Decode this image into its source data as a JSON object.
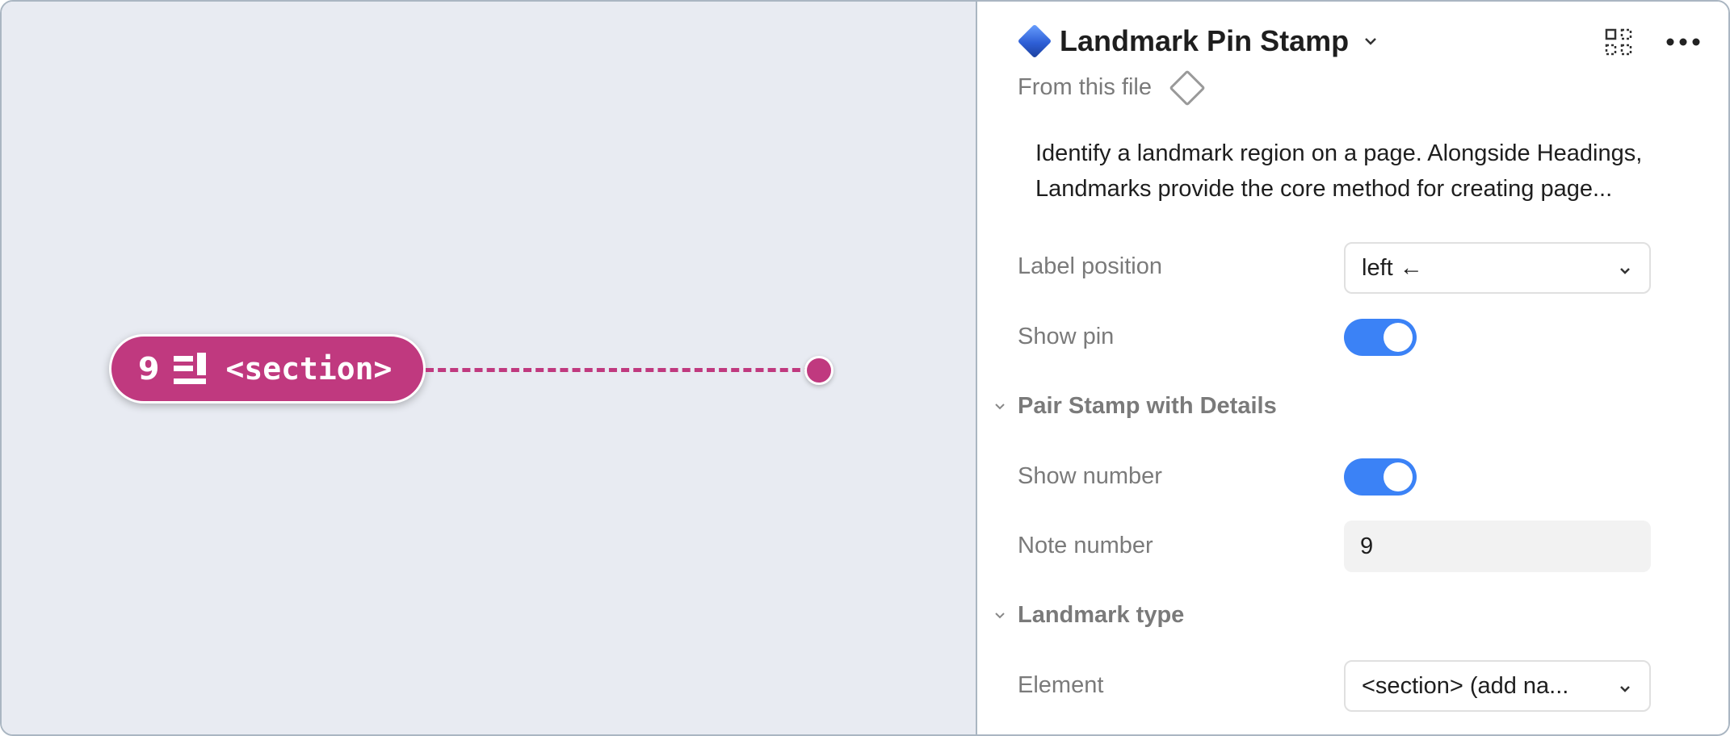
{
  "canvas": {
    "stamp": {
      "number": "9",
      "tag": "<section>"
    },
    "colors": {
      "stamp": "#c0397f",
      "canvas_bg": "#e8ebf2"
    }
  },
  "panel": {
    "title": "Landmark Pin Stamp",
    "source_label": "From this file",
    "description": "Identify a landmark region on a page. Alongside Headings, Landmarks provide the core method for creating page...",
    "properties": {
      "label_position": {
        "label": "Label position",
        "value": "left ←"
      },
      "show_pin": {
        "label": "Show pin",
        "checked": true
      },
      "pair_section": "Pair Stamp with Details",
      "show_number": {
        "label": "Show number",
        "checked": true
      },
      "note_number": {
        "label": "Note number",
        "value": "9"
      },
      "landmark_section": "Landmark type",
      "element": {
        "label": "Element",
        "value": "<section> (add na..."
      }
    },
    "icons": {
      "component": "diamond-icon",
      "title_chevron": "chevron-down-icon",
      "instance": "instance-icon",
      "more": "more-icon",
      "source": "outline-diamond-icon"
    },
    "colors": {
      "toggle_on": "#3b82f6"
    }
  }
}
